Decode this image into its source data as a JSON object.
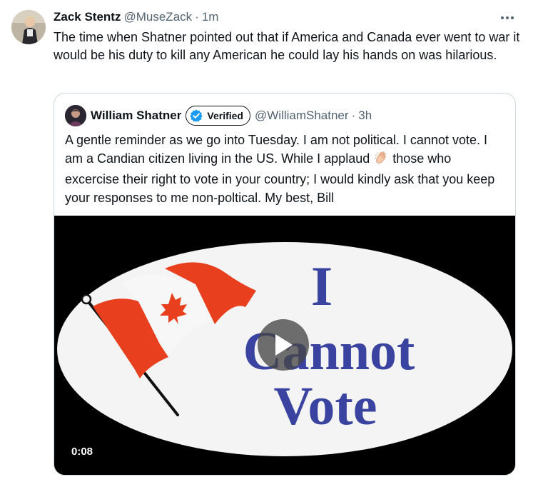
{
  "tweet": {
    "author_name": "Zack Stentz",
    "author_handle": "@MuseZack",
    "separator": "·",
    "time": "1m",
    "text": "The time when Shatner pointed out that if America and Canada ever went to war it would be his duty to kill any American he could lay his hands on was hilarious."
  },
  "quoted": {
    "author_name": "William Shatner",
    "verified_label": "Verified",
    "author_handle": "@WilliamShatner",
    "separator": "·",
    "time": "3h",
    "text_before_emoji": "A gentle reminder as we go into Tuesday.  I am not political.  I cannot vote.  I am a Candian citizen living in the US.  While I applaud ",
    "emoji": "clapping-hands",
    "text_after_emoji": " those who excercise their right to vote in your country; I would kindly ask that you keep your responses to me non-poltical. My best, Bill",
    "media": {
      "line1": "I",
      "line2": "Cannot",
      "line3": "Vote",
      "duration": "0:08",
      "text_color": "#3a44a0",
      "flag_color": "#e8401f"
    }
  },
  "colors": {
    "text": "#0f1419",
    "muted": "#536471",
    "border": "#cfd9de",
    "verified_blue": "#1d9bf0"
  }
}
